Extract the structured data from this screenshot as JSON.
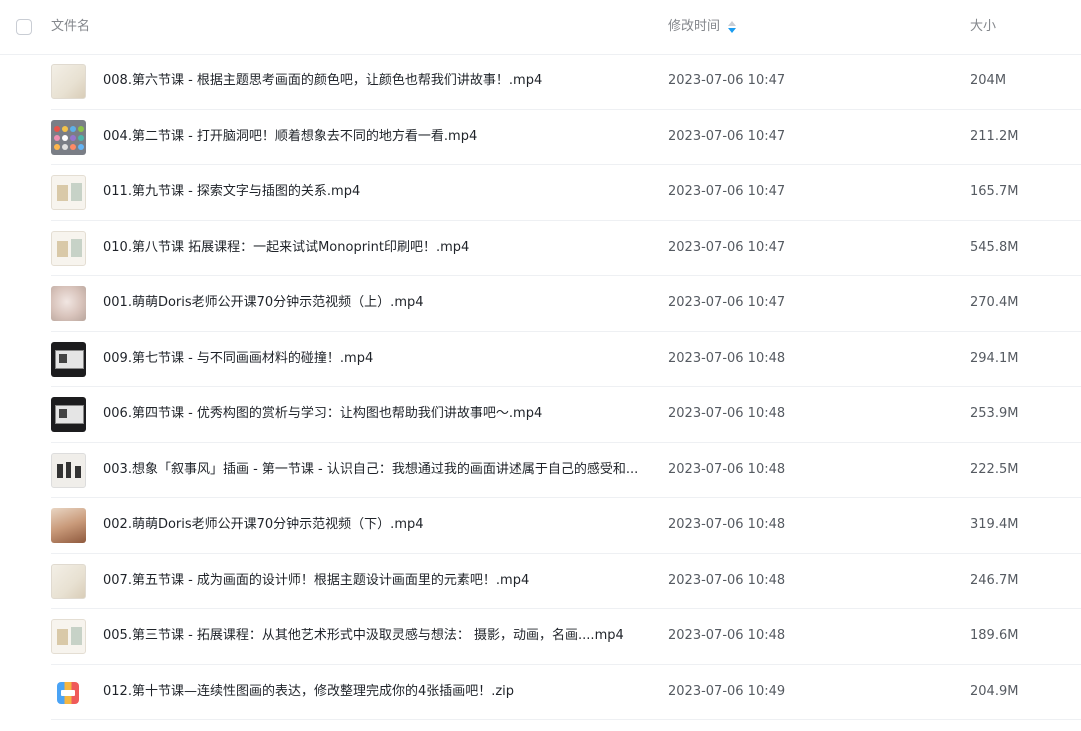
{
  "header": {
    "name_label": "文件名",
    "time_label": "修改时间",
    "size_label": "大小"
  },
  "files": [
    {
      "name": "008.第六节课 - 根据主题思考画面的颜色吧，让颜色也帮我们讲故事！.mp4",
      "time": "2023-07-06 10:47",
      "size": "204M",
      "thumb": "light"
    },
    {
      "name": "004.第二节课 - 打开脑洞吧！顺着想象去不同的地方看一看.mp4",
      "time": "2023-07-06 10:47",
      "size": "211.2M",
      "thumb": "grid"
    },
    {
      "name": "011.第九节课 - 探索文字与插图的关系.mp4",
      "time": "2023-07-06 10:47",
      "size": "165.7M",
      "thumb": "paper"
    },
    {
      "name": "010.第八节课 拓展课程：一起来试试Monoprint印刷吧！.mp4",
      "time": "2023-07-06 10:47",
      "size": "545.8M",
      "thumb": "paper"
    },
    {
      "name": "001.萌萌Doris老师公开课70分钟示范视频（上）.mp4",
      "time": "2023-07-06 10:47",
      "size": "270.4M",
      "thumb": "face"
    },
    {
      "name": "009.第七节课 - 与不同画画材料的碰撞！.mp4",
      "time": "2023-07-06 10:48",
      "size": "294.1M",
      "thumb": "dark"
    },
    {
      "name": "006.第四节课 - 优秀构图的赏析与学习：让构图也帮助我们讲故事吧～.mp4",
      "time": "2023-07-06 10:48",
      "size": "253.9M",
      "thumb": "dark"
    },
    {
      "name": "003.想象「叙事风」插画 - 第一节课 - 认识自己：我想通过我的画面讲述属于自己的感受和...",
      "time": "2023-07-06 10:48",
      "size": "222.5M",
      "thumb": "sketch"
    },
    {
      "name": "002.萌萌Doris老师公开课70分钟示范视频（下）.mp4",
      "time": "2023-07-06 10:48",
      "size": "319.4M",
      "thumb": "hand"
    },
    {
      "name": "007.第五节课 - 成为画面的设计师！根据主题设计画面里的元素吧！.mp4",
      "time": "2023-07-06 10:48",
      "size": "246.7M",
      "thumb": "light"
    },
    {
      "name": "005.第三节课 - 拓展课程：从其他艺术形式中汲取灵感与想法：  摄影，动画，名画....mp4",
      "time": "2023-07-06 10:48",
      "size": "189.6M",
      "thumb": "paper"
    },
    {
      "name": "012.第十节课—连续性图画的表达，修改整理完成你的4张插画吧！.zip",
      "time": "2023-07-06 10:49",
      "size": "204.9M",
      "thumb": "zip"
    }
  ]
}
